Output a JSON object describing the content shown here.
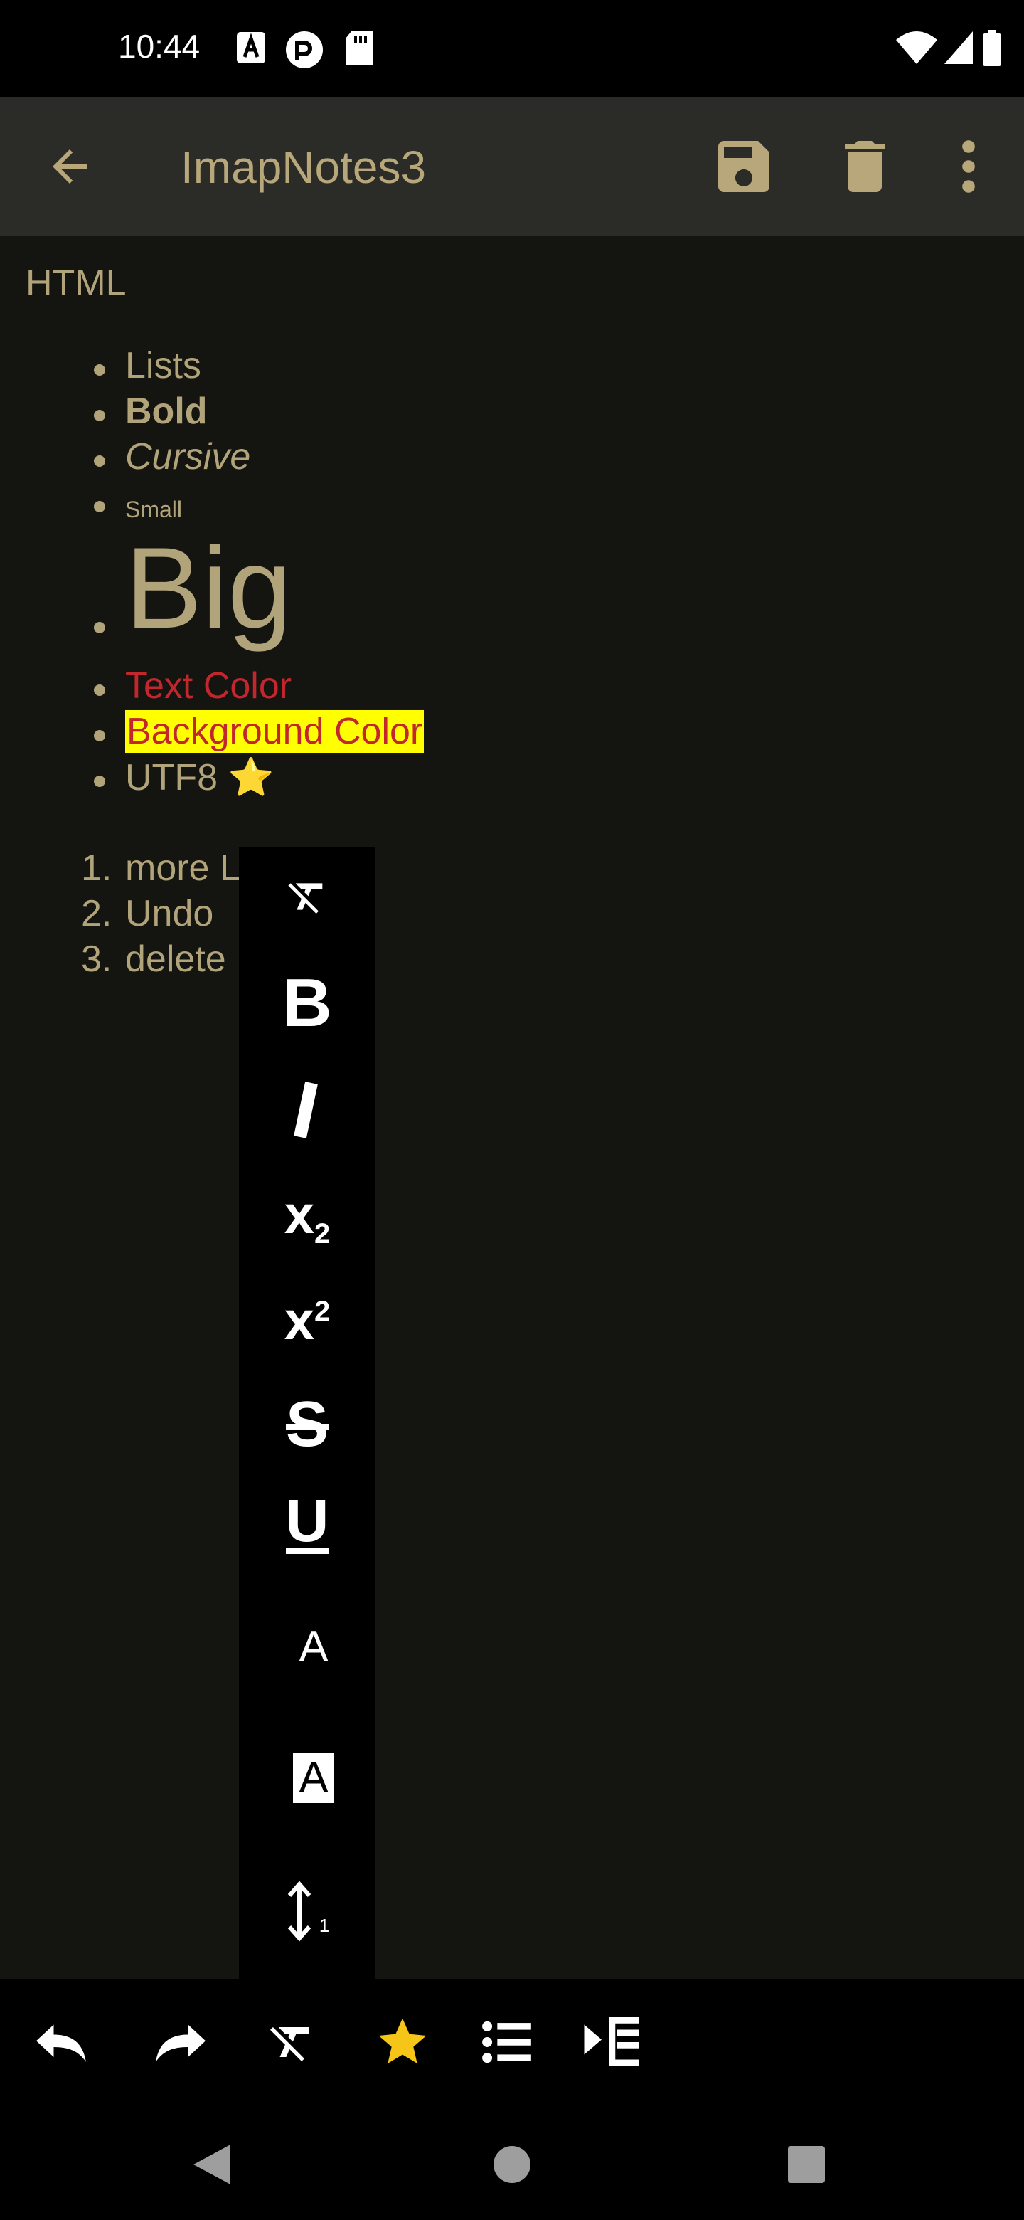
{
  "status": {
    "time": "10:44"
  },
  "appbar": {
    "title": "ImapNotes3"
  },
  "note": {
    "heading": "HTML",
    "list": [
      "Lists",
      "Bold",
      "Cursive",
      "Small",
      "Big",
      "Text Color",
      "Background Color",
      "UTF8 ⭐"
    ],
    "ordered": [
      "more L",
      "Undo",
      "delete"
    ],
    "ordered_numbers": [
      "1.",
      "2.",
      "3."
    ]
  },
  "popup": {
    "text_color_glyph": "A",
    "bg_color_glyph": "A",
    "line_height_value": "1"
  },
  "colors": {
    "text": "#b2a47a",
    "accent": "#b8a77a",
    "red_text": "#c1272d",
    "highlight_bg": "#ffff00",
    "star": "#f5c518",
    "background": "#141410",
    "appbar": "#2b2b27"
  }
}
